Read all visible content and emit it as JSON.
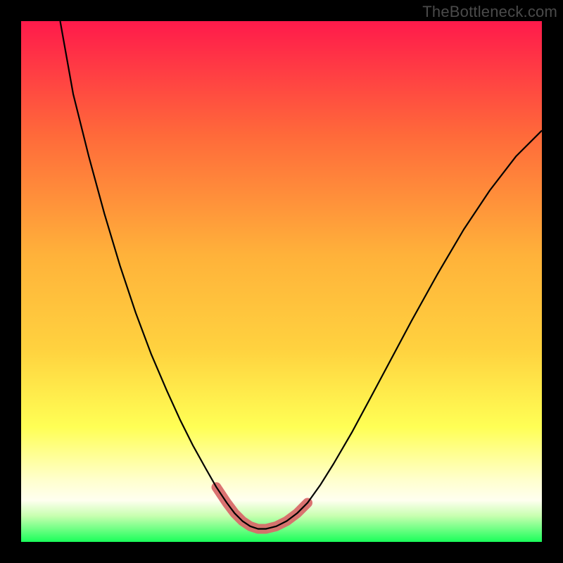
{
  "watermark": "TheBottleneck.com",
  "chart_data": {
    "type": "line",
    "title": "",
    "xlabel": "",
    "ylabel": "",
    "xlim": [
      0,
      1
    ],
    "ylim": [
      0,
      1
    ],
    "background_gradient": {
      "top": "#ff1a4b",
      "mid_upper": "#ff7a3a",
      "mid": "#ffd23f",
      "mid_lower": "#ffff66",
      "pale": "#ffffcc",
      "bottom": "#1aff5a"
    },
    "series": [
      {
        "name": "bottleneck-curve",
        "stroke": "#000000",
        "stroke_width": 2.2,
        "x": [
          0.075,
          0.1,
          0.13,
          0.16,
          0.19,
          0.22,
          0.25,
          0.28,
          0.305,
          0.33,
          0.355,
          0.375,
          0.395,
          0.41,
          0.425,
          0.44,
          0.455,
          0.47,
          0.49,
          0.51,
          0.53,
          0.55,
          0.575,
          0.6,
          0.635,
          0.67,
          0.71,
          0.75,
          0.8,
          0.85,
          0.9,
          0.95,
          1.0
        ],
        "y": [
          1.0,
          0.86,
          0.74,
          0.63,
          0.53,
          0.44,
          0.36,
          0.29,
          0.235,
          0.185,
          0.14,
          0.105,
          0.075,
          0.055,
          0.04,
          0.03,
          0.025,
          0.025,
          0.03,
          0.04,
          0.055,
          0.075,
          0.11,
          0.15,
          0.21,
          0.275,
          0.35,
          0.425,
          0.515,
          0.6,
          0.675,
          0.74,
          0.79
        ]
      },
      {
        "name": "highlight-valley",
        "stroke": "#d86a6a",
        "stroke_width": 14,
        "linecap": "round",
        "x": [
          0.375,
          0.395,
          0.41,
          0.425,
          0.44,
          0.455,
          0.47,
          0.49,
          0.51,
          0.53,
          0.55
        ],
        "y": [
          0.105,
          0.075,
          0.055,
          0.04,
          0.03,
          0.025,
          0.025,
          0.03,
          0.04,
          0.055,
          0.075
        ]
      }
    ]
  }
}
